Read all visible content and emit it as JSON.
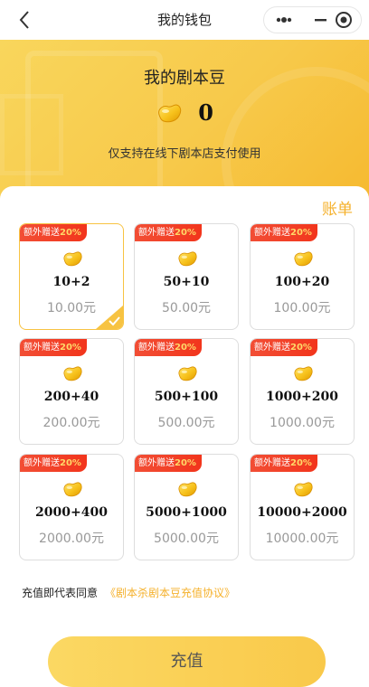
{
  "nav": {
    "title": "我的钱包"
  },
  "hero": {
    "title": "我的剧本豆",
    "balance": "0",
    "note": "仅支持在线下剧本店支付使用"
  },
  "bill_label": "账单",
  "packages": [
    {
      "badge_text": "额外赠送",
      "badge_pct": "20%",
      "amount": "10+2",
      "price": "10.00元",
      "selected": true
    },
    {
      "badge_text": "额外赠送",
      "badge_pct": "20%",
      "amount": "50+10",
      "price": "50.00元",
      "selected": false
    },
    {
      "badge_text": "额外赠送",
      "badge_pct": "20%",
      "amount": "100+20",
      "price": "100.00元",
      "selected": false
    },
    {
      "badge_text": "额外赠送",
      "badge_pct": "20%",
      "amount": "200+40",
      "price": "200.00元",
      "selected": false
    },
    {
      "badge_text": "额外赠送",
      "badge_pct": "20%",
      "amount": "500+100",
      "price": "500.00元",
      "selected": false
    },
    {
      "badge_text": "额外赠送",
      "badge_pct": "20%",
      "amount": "1000+200",
      "price": "1000.00元",
      "selected": false
    },
    {
      "badge_text": "额外赠送",
      "badge_pct": "20%",
      "amount": "2000+400",
      "price": "2000.00元",
      "selected": false
    },
    {
      "badge_text": "额外赠送",
      "badge_pct": "20%",
      "amount": "5000+1000",
      "price": "5000.00元",
      "selected": false
    },
    {
      "badge_text": "额外赠送",
      "badge_pct": "20%",
      "amount": "10000+2000",
      "price": "10000.00元",
      "selected": false
    }
  ],
  "agreement": {
    "prefix": "充值即代表同意",
    "link": "《剧本杀剧本豆充值协议》"
  },
  "pay_button": "充值",
  "colors": {
    "accent": "#f5b12c",
    "badge": "#f2351c",
    "hero": "#f7c94a"
  },
  "icons": {
    "back": "chevron-left-icon",
    "more": "more-icon",
    "minimize": "minimize-icon",
    "close": "close-circle-icon",
    "bean": "bean-icon",
    "check": "check-icon"
  }
}
